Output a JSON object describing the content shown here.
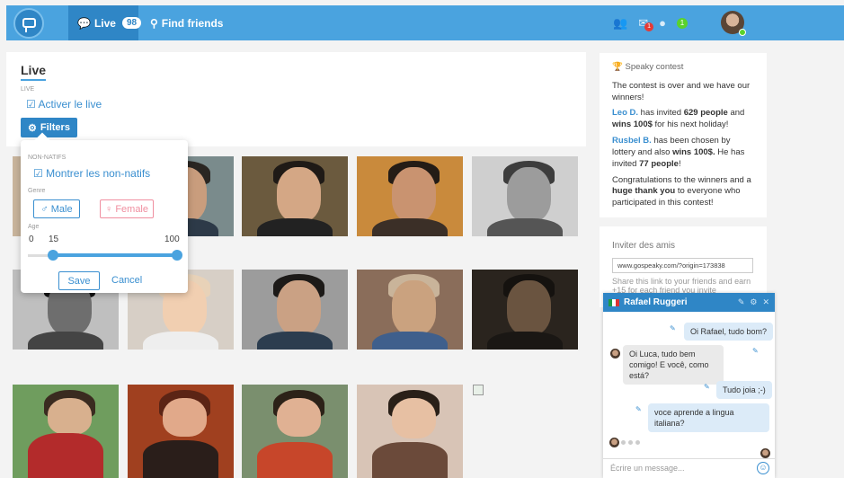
{
  "header": {
    "live_label": "Live",
    "live_count": "98",
    "find_friends_label": "Find friends",
    "mail_badge": "1",
    "green_badge": "1"
  },
  "live": {
    "title": "Live",
    "section_label": "LIVE",
    "activate_label": "Activer le live",
    "filters_label": "Filters"
  },
  "filters": {
    "non_natives_section": "NON-NATIFS",
    "show_non_natives_label": "Montrer les non-natifs",
    "gender_label": "Genre",
    "male_label": "Male",
    "female_label": "Female",
    "age_label": "Age",
    "age_scale_min": "0",
    "age_min": "15",
    "age_max": "100",
    "age_min_fraction": 0.15,
    "age_max_fraction": 1.0,
    "save_label": "Save",
    "cancel_label": "Cancel"
  },
  "contest": {
    "title": "Speaky contest",
    "intro": "The contest is over and we have our winners!",
    "w1_name": "Leo D.",
    "w1_text_a": " has invited ",
    "w1_bold": "629 people",
    "w1_text_b": " and ",
    "w1_prize": "wins 100$",
    "w1_text_c": " for his next holiday!",
    "w2_name": "Rusbel B.",
    "w2_text_a": " has been chosen by lottery and also ",
    "w2_prize": "wins 100$.",
    "w2_text_b": " He has invited ",
    "w2_bold": "77 people",
    "w2_text_c": "!",
    "outro_a": "Congratulations to the winners and a ",
    "outro_bold": "huge thank you",
    "outro_b": " to everyone who participated in this contest!"
  },
  "invite": {
    "title": "Inviter des amis",
    "url": "www.gospeaky.com/?origin=173838",
    "share_text": "Share this link to your friends and earn +15 for each friend you invite"
  },
  "chat": {
    "contact_name": "Rafael Ruggeri",
    "messages": [
      {
        "from": "me",
        "text": "Oi Rafael, tudo bom?"
      },
      {
        "from": "them",
        "text": "Oi Luca, tudo bem comigo! E você, como está?"
      },
      {
        "from": "me",
        "text": "Tudo joia ;-)"
      },
      {
        "from": "me",
        "text": "voce aprende a lingua italiana?"
      }
    ],
    "input_placeholder": "Écrire un message..."
  },
  "icons": {
    "logo": "speech-bubble-logo",
    "live": "chat-bubbles-icon",
    "find": "search-icon",
    "filters": "gear-icon",
    "contest": "trophy-icon"
  },
  "colors": {
    "primary": "#4aa3df",
    "primary_dark": "#2f86c6",
    "female": "#f08fa0",
    "online": "#5ad22c"
  }
}
